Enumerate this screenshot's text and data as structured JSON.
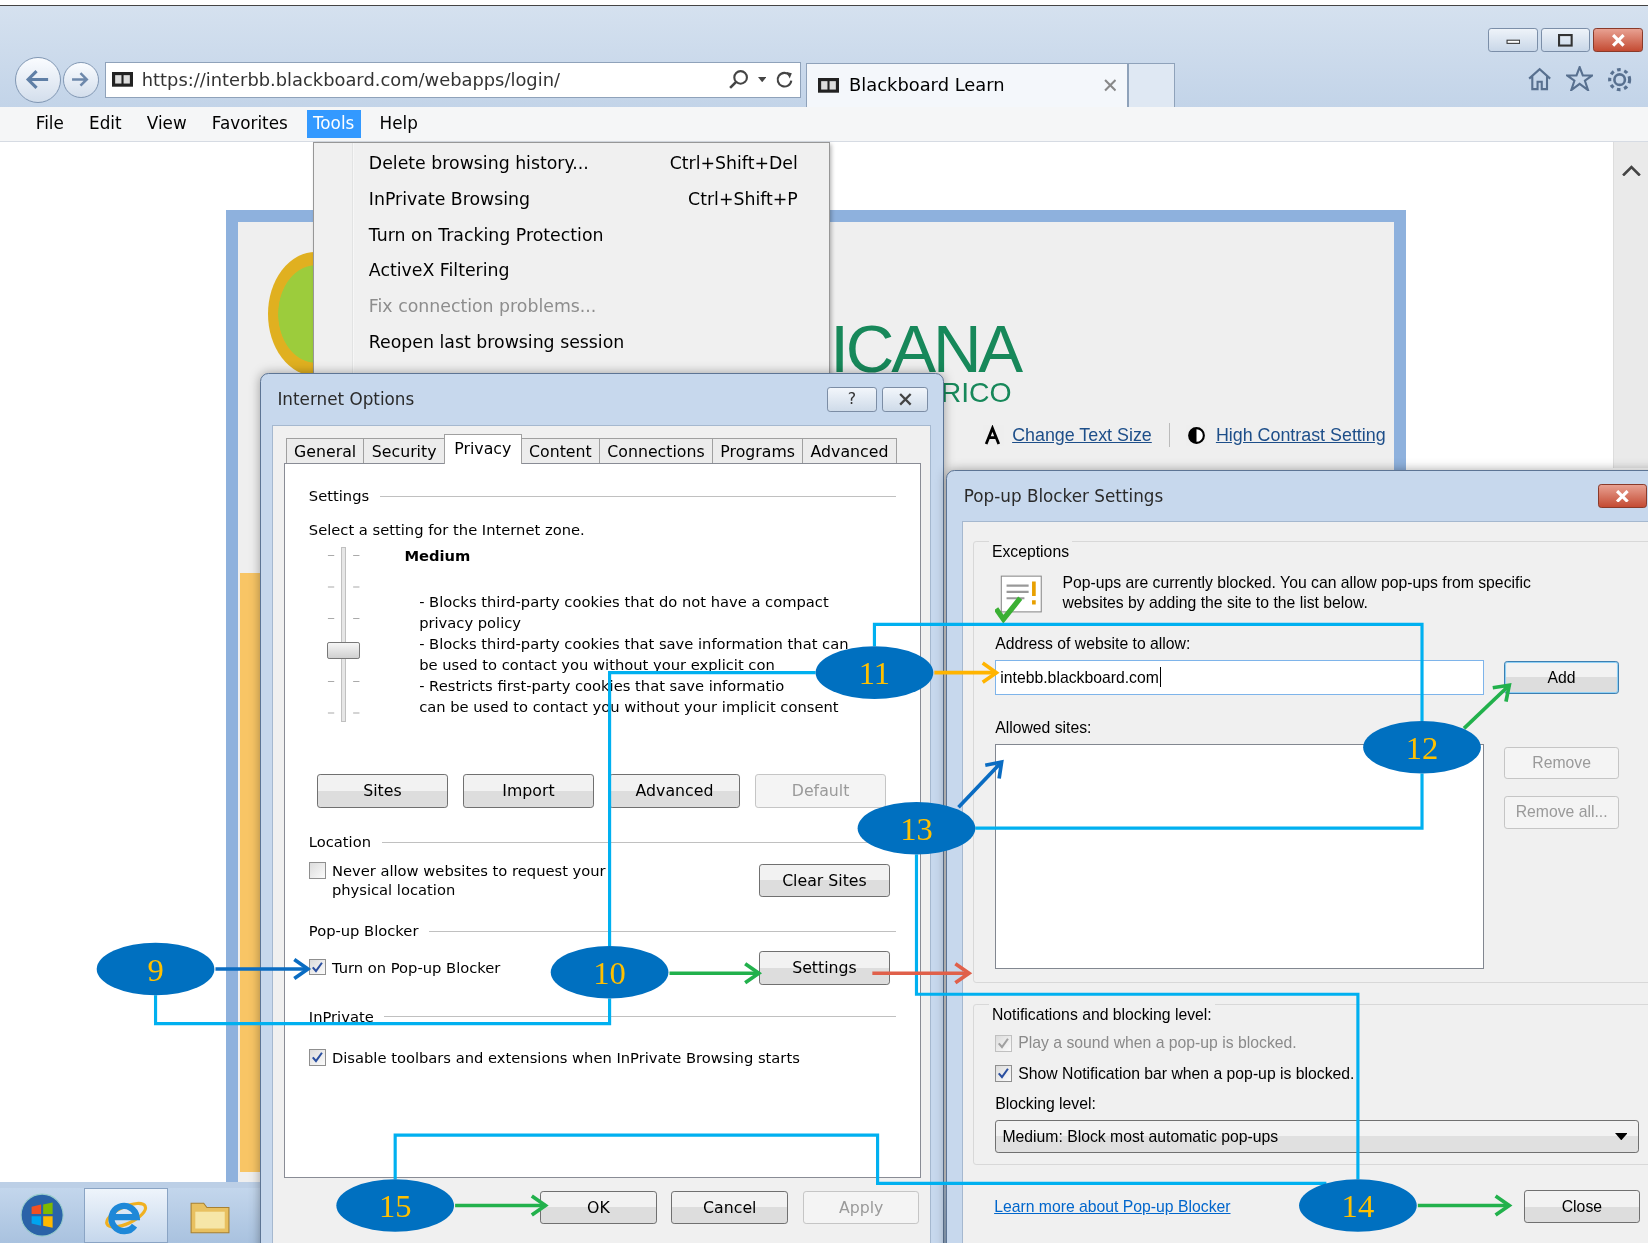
{
  "browser": {
    "address": "https://interbb.blackboard.com/webapps/login/",
    "tabs": [
      {
        "title": "Blackboard Learn"
      }
    ],
    "menu": [
      {
        "label": "File",
        "selected": false
      },
      {
        "label": "Edit",
        "selected": false
      },
      {
        "label": "View",
        "selected": false
      },
      {
        "label": "Favorites",
        "selected": false
      },
      {
        "label": "Tools",
        "selected": true
      },
      {
        "label": "Help",
        "selected": false
      }
    ]
  },
  "tools_menu": [
    {
      "label": "Delete browsing history...",
      "shortcut": "Ctrl+Shift+Del",
      "disabled": false
    },
    {
      "label": "InPrivate Browsing",
      "shortcut": "Ctrl+Shift+P",
      "disabled": false
    },
    {
      "label": "Turn on Tracking Protection",
      "disabled": false
    },
    {
      "label": "ActiveX Filtering",
      "disabled": false
    },
    {
      "label": "Fix connection problems...",
      "disabled": true
    },
    {
      "label": "Reopen last browsing session",
      "disabled": false
    }
  ],
  "page": {
    "logo_text": "ICANA",
    "logo_subtext": "RICO",
    "links": [
      "Change Text Size",
      "High Contrast Setting"
    ]
  },
  "internet_options": {
    "title": "Internet Options",
    "help_button": "?",
    "tabs": [
      {
        "label": "General",
        "selected": false
      },
      {
        "label": "Security",
        "selected": false
      },
      {
        "label": "Privacy",
        "selected": true
      },
      {
        "label": "Content",
        "selected": false
      },
      {
        "label": "Connections",
        "selected": false
      },
      {
        "label": "Programs",
        "selected": false
      },
      {
        "label": "Advanced",
        "selected": false
      }
    ],
    "settings": {
      "heading": "Settings",
      "prompt": "Select a setting for the Internet zone.",
      "level_name": "Medium",
      "level": 0.4,
      "description_lines": [
        "- Blocks third-party cookies that do not have a compact",
        "privacy policy",
        "- Blocks third-party cookies that save information that can",
        "be used to contact you without your explicit con",
        "- Restricts first-party cookies that save informatio",
        "can be used to contact you without your implicit consent"
      ]
    },
    "settings_buttons": [
      {
        "label": "Sites",
        "disabled": false
      },
      {
        "label": "Import",
        "disabled": false
      },
      {
        "label": "Advanced",
        "disabled": false
      },
      {
        "label": "Default",
        "disabled": true
      }
    ],
    "location": {
      "heading": "Location",
      "checkbox": {
        "label": "Never allow websites to request your physical location",
        "checked": false
      },
      "button": "Clear Sites"
    },
    "popup_blocker": {
      "heading": "Pop-up Blocker",
      "checkbox": {
        "label": "Turn on Pop-up Blocker",
        "checked": true
      },
      "button": "Settings"
    },
    "inprivate": {
      "heading": "InPrivate",
      "checkbox": {
        "label": "Disable toolbars and extensions when InPrivate Browsing starts",
        "checked": true
      }
    },
    "buttons": [
      {
        "label": "OK",
        "disabled": false
      },
      {
        "label": "Cancel",
        "disabled": false
      },
      {
        "label": "Apply",
        "disabled": true
      }
    ]
  },
  "popup_settings": {
    "title": "Pop-up Blocker Settings",
    "exceptions": {
      "heading": "Exceptions",
      "message": "Pop-ups are currently blocked.  You can allow pop-ups from specific websites by adding the site to the list below.",
      "address_label": "Address of website to allow:",
      "address_value": "intebb.blackboard.com",
      "add_button": "Add",
      "allowed_label": "Allowed sites:",
      "side_buttons": [
        {
          "label": "Remove",
          "disabled": true
        },
        {
          "label": "Remove all...",
          "disabled": true
        }
      ]
    },
    "notifications": {
      "heading": "Notifications and blocking level:",
      "options": [
        {
          "label": "Play a sound when a pop-up is blocked.",
          "checked": true,
          "disabled": true
        },
        {
          "label": "Show Notification bar when a pop-up is blocked.",
          "checked": true,
          "disabled": false
        }
      ],
      "blocking_label": "Blocking level:",
      "blocking_value": "Medium: Block most automatic pop-ups"
    },
    "learn_more": "Learn more about Pop-up Blocker",
    "close_button": "Close"
  },
  "callouts": [
    {
      "label": "9"
    },
    {
      "label": "10"
    },
    {
      "label": "11"
    },
    {
      "label": "12"
    },
    {
      "label": "13"
    },
    {
      "label": "14"
    },
    {
      "label": "15"
    }
  ]
}
